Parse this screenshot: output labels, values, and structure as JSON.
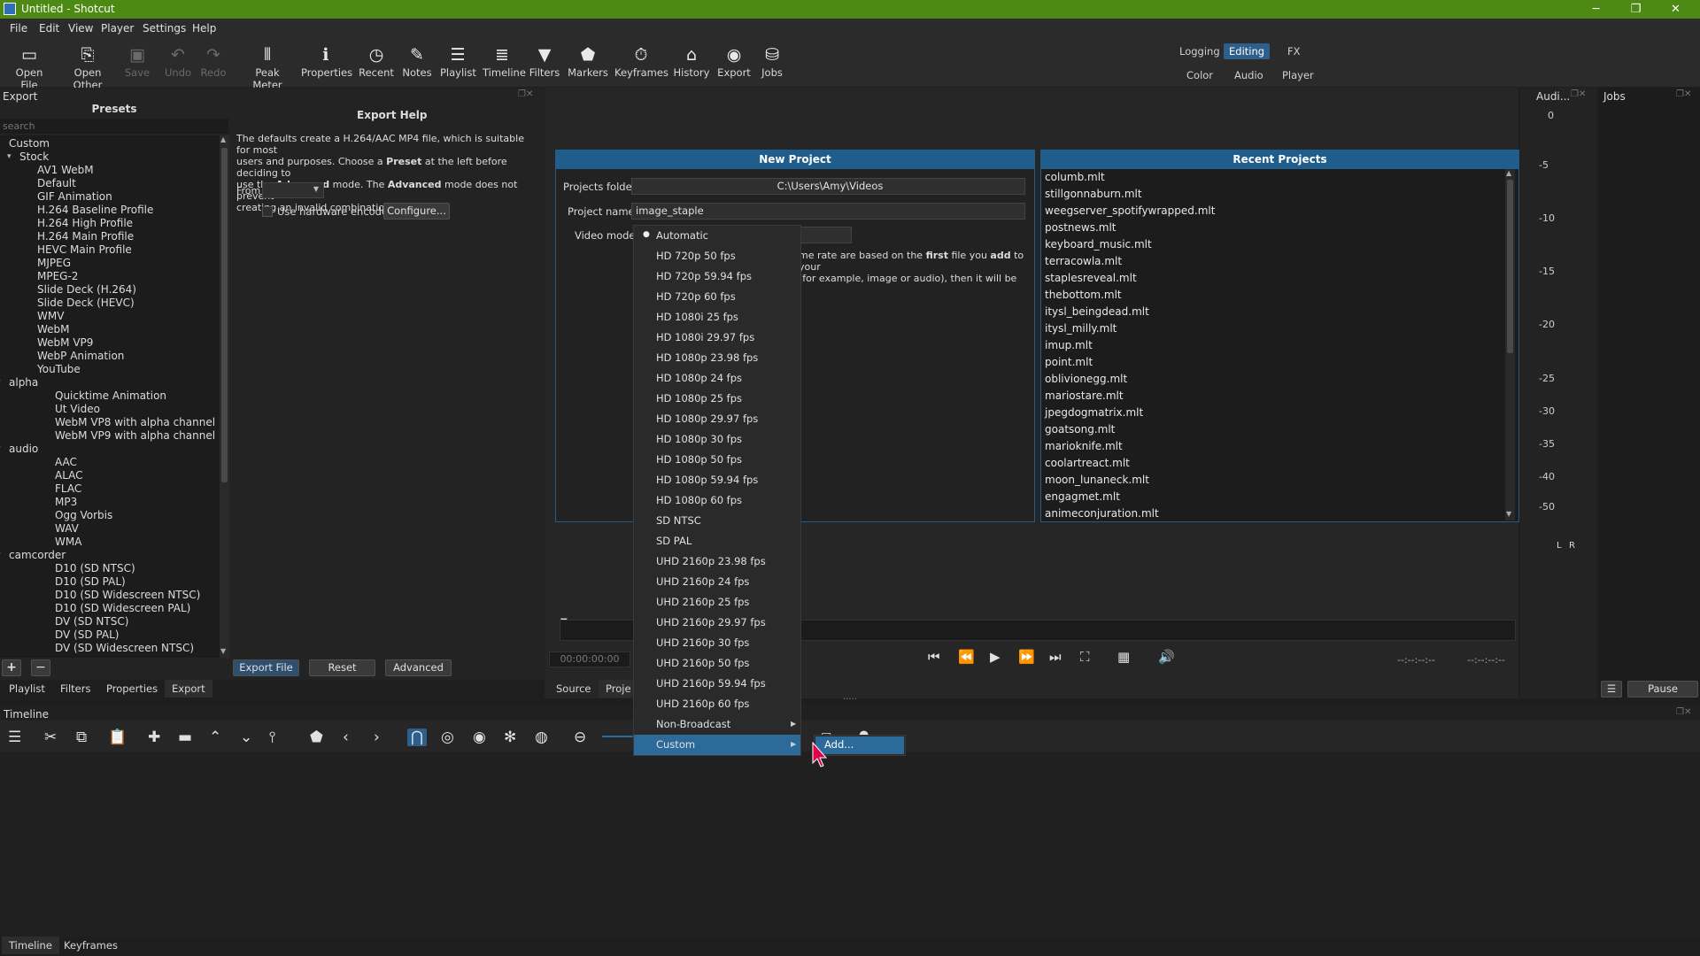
{
  "window": {
    "title": "Untitled - Shotcut",
    "minimize": "─",
    "restore": "❐",
    "close": "✕"
  },
  "menu": [
    "File",
    "Edit",
    "View",
    "Player",
    "Settings",
    "Help"
  ],
  "toolbar": {
    "open_file": "Open File",
    "open_other": "Open Other",
    "save": "Save",
    "undo": "Undo",
    "redo": "Redo",
    "peak_meter": "Peak Meter",
    "properties": "Properties",
    "recent": "Recent",
    "notes": "Notes",
    "playlist": "Playlist",
    "timeline": "Timeline",
    "filters": "Filters",
    "markers": "Markers",
    "keyframes": "Keyframes",
    "history": "History",
    "export": "Export",
    "jobs": "Jobs"
  },
  "layouts": {
    "logging": "Logging",
    "editing": "Editing",
    "fx": "FX",
    "color": "Color",
    "audio": "Audio",
    "player": "Player"
  },
  "export_panel": {
    "dock_title": "Export",
    "presets_title": "Presets",
    "search_placeholder": "search",
    "presets": [
      {
        "label": "Custom",
        "level": 1
      },
      {
        "label": "Stock",
        "level": 0,
        "expanded": true
      },
      {
        "label": "AV1 WebM",
        "level": 2
      },
      {
        "label": "Default",
        "level": 2
      },
      {
        "label": "GIF Animation",
        "level": 2
      },
      {
        "label": "H.264 Baseline Profile",
        "level": 2
      },
      {
        "label": "H.264 High Profile",
        "level": 2
      },
      {
        "label": "H.264 Main Profile",
        "level": 2
      },
      {
        "label": "HEVC Main Profile",
        "level": 2
      },
      {
        "label": "MJPEG",
        "level": 2
      },
      {
        "label": "MPEG-2",
        "level": 2
      },
      {
        "label": "Slide Deck (H.264)",
        "level": 2
      },
      {
        "label": "Slide Deck (HEVC)",
        "level": 2
      },
      {
        "label": "WMV",
        "level": 2
      },
      {
        "label": "WebM",
        "level": 2
      },
      {
        "label": "WebM VP9",
        "level": 2
      },
      {
        "label": "WebP Animation",
        "level": 2
      },
      {
        "label": "YouTube",
        "level": 2
      },
      {
        "label": "alpha",
        "level": 1,
        "expanded": true
      },
      {
        "label": "Quicktime Animation",
        "level": 3
      },
      {
        "label": "Ut Video",
        "level": 3
      },
      {
        "label": "WebM VP8 with alpha channel",
        "level": 3
      },
      {
        "label": "WebM VP9 with alpha channel",
        "level": 3
      },
      {
        "label": "audio",
        "level": 1,
        "expanded": true
      },
      {
        "label": "AAC",
        "level": 3
      },
      {
        "label": "ALAC",
        "level": 3
      },
      {
        "label": "FLAC",
        "level": 3
      },
      {
        "label": "MP3",
        "level": 3
      },
      {
        "label": "Ogg Vorbis",
        "level": 3
      },
      {
        "label": "WAV",
        "level": 3
      },
      {
        "label": "WMA",
        "level": 3
      },
      {
        "label": "camcorder",
        "level": 1,
        "expanded": true
      },
      {
        "label": "D10 (SD NTSC)",
        "level": 3
      },
      {
        "label": "D10 (SD PAL)",
        "level": 3
      },
      {
        "label": "D10 (SD Widescreen NTSC)",
        "level": 3
      },
      {
        "label": "D10 (SD Widescreen PAL)",
        "level": 3
      },
      {
        "label": "DV (SD NTSC)",
        "level": 3
      },
      {
        "label": "DV (SD PAL)",
        "level": 3
      },
      {
        "label": "DV (SD Widescreen NTSC)",
        "level": 3
      }
    ],
    "help_title": "Export Help",
    "help_line1": "The defaults create a H.264/AAC MP4 file, which is suitable for most",
    "help_line2a": "users and purposes. Choose a ",
    "help_line2b": "Preset",
    "help_line2c": " at the left before deciding to",
    "help_line3a": "use the ",
    "help_line3b": "Advanced",
    "help_line3c": " mode. The ",
    "help_line3d": "Advanced",
    "help_line3e": " mode does not prevent",
    "help_line4": "creating an invalid combination of options!",
    "from_label": "From",
    "hw_encoder_label": "Use hardware encoder",
    "configure_label": "Configure...",
    "add_label": "+",
    "remove_label": "−",
    "export_file_label": "Export File",
    "reset_label": "Reset",
    "advanced_label": "Advanced"
  },
  "left_tabs": [
    "Playlist",
    "Filters",
    "Properties",
    "Export"
  ],
  "new_project": {
    "title": "New Project",
    "folder_label": "Projects folder",
    "folder_value": "C:\\Users\\Amy\\Videos",
    "name_label": "Project name",
    "name_value": "image_staple",
    "video_mode_label": "Video mode",
    "note_line1a": "me rate are based on the ",
    "note_line1b": "first",
    "note_line1c": " file you ",
    "note_line1d": "add",
    "note_line1e": " to your",
    "note_line2": "(for example, image or audio), then it will be"
  },
  "recent_projects": {
    "title": "Recent Projects",
    "items": [
      "columb.mlt",
      "stillgonnaburn.mlt",
      "weegserver_spotifywrapped.mlt",
      "postnews.mlt",
      "keyboard_music.mlt",
      "terracowla.mlt",
      "staplesreveal.mlt",
      "thebottom.mlt",
      "itysl_beingdead.mlt",
      "itysl_milly.mlt",
      "imup.mlt",
      "point.mlt",
      "oblivionegg.mlt",
      "mariostare.mlt",
      "jpegdogmatrix.mlt",
      "goatsong.mlt",
      "marioknife.mlt",
      "coolartreact.mlt",
      "moon_lunaneck.mlt",
      "engagmet.mlt",
      "animeconjuration.mlt"
    ]
  },
  "video_mode_menu": {
    "items": [
      "Automatic",
      "HD 720p 50 fps",
      "HD 720p 59.94 fps",
      "HD 720p 60 fps",
      "HD 1080i 25 fps",
      "HD 1080i 29.97 fps",
      "HD 1080p 23.98 fps",
      "HD 1080p 24 fps",
      "HD 1080p 25 fps",
      "HD 1080p 29.97 fps",
      "HD 1080p 30 fps",
      "HD 1080p 50 fps",
      "HD 1080p 59.94 fps",
      "HD 1080p 60 fps",
      "SD NTSC",
      "SD PAL",
      "UHD 2160p 23.98 fps",
      "UHD 2160p 24 fps",
      "UHD 2160p 25 fps",
      "UHD 2160p 29.97 fps",
      "UHD 2160p 30 fps",
      "UHD 2160p 50 fps",
      "UHD 2160p 59.94 fps",
      "UHD 2160p 60 fps",
      "Non-Broadcast",
      "Custom"
    ],
    "checked": "Automatic",
    "highlighted": "Custom",
    "submenu_item": "Add..."
  },
  "player": {
    "timecode": "00:00:00:00",
    "in_point": "--:--:--:--",
    "out_point": "--:--:--:--",
    "source_tab": "Source",
    "project_tab": "Proje"
  },
  "audio_meter": {
    "title": "Audi...",
    "scale": [
      "0",
      "-5",
      "-10",
      "-15",
      "-20",
      "-25",
      "-30",
      "-35",
      "-40",
      "-50"
    ],
    "left": "L",
    "right": "R"
  },
  "jobs": {
    "title": "Jobs",
    "pause_label": "Pause"
  },
  "timeline": {
    "title": "Timeline"
  },
  "bottom_tabs": [
    "Timeline",
    "Keyframes"
  ],
  "colors": {
    "accent": "#1f5d8c",
    "titlebar": "#4d8a14",
    "highlight": "#2c6a9a"
  }
}
